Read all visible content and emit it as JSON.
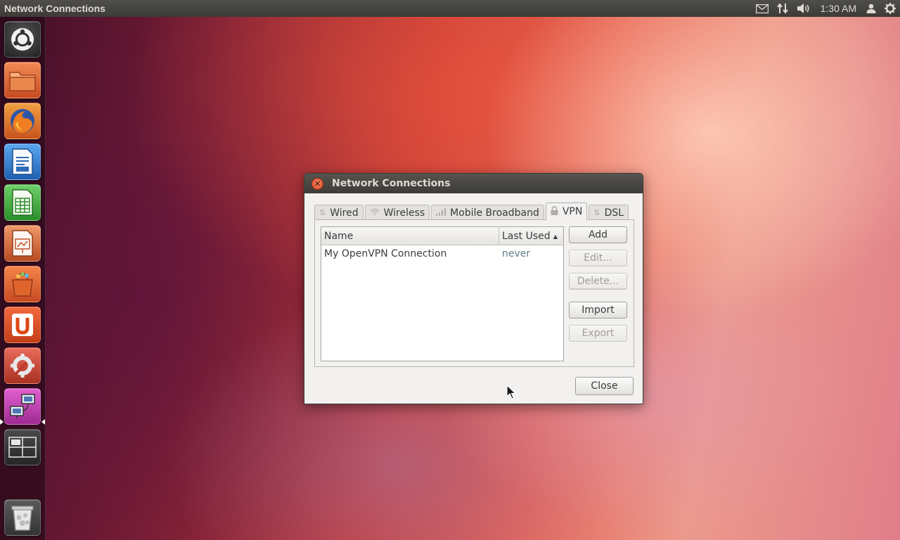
{
  "panel": {
    "title": "Network Connections",
    "clock": "1:30 AM",
    "indicators": [
      "mail-icon",
      "network-transfer-icon",
      "volume-icon",
      "user-icon",
      "power-gear-icon"
    ]
  },
  "launcher": {
    "items": [
      {
        "name": "dash-home-icon",
        "color": "#2c2c2c"
      },
      {
        "name": "files-folder-icon",
        "color": "#d9582f"
      },
      {
        "name": "firefox-icon",
        "color": "#e66d1f"
      },
      {
        "name": "writer-icon",
        "color": "#2f7fd6"
      },
      {
        "name": "calc-icon",
        "color": "#3fae3a"
      },
      {
        "name": "impress-icon",
        "color": "#c9542d"
      },
      {
        "name": "software-center-icon",
        "color": "#e2632f"
      },
      {
        "name": "ubuntu-one-icon",
        "color": "#e2522a"
      },
      {
        "name": "system-settings-icon",
        "color": "#d54a3a"
      },
      {
        "name": "network-connections-icon",
        "color": "#c93fb4"
      },
      {
        "name": "workspace-switcher-icon",
        "color": "#3a3a3a"
      },
      {
        "name": "trash-icon",
        "color": "#4a4a4a"
      }
    ]
  },
  "dialog": {
    "title": "Network Connections",
    "tabs": [
      "Wired",
      "Wireless",
      "Mobile Broadband",
      "VPN",
      "DSL"
    ],
    "active_tab": "VPN",
    "columns": {
      "name": "Name",
      "last_used": "Last Used"
    },
    "connections": [
      {
        "name": "My OpenVPN Connection",
        "last_used": "never"
      }
    ],
    "buttons": {
      "add": "Add",
      "edit": "Edit...",
      "delete": "Delete...",
      "import": "Import",
      "export": "Export",
      "close": "Close"
    }
  },
  "colors": {
    "panel": "#3c3b37",
    "dialog_bg": "#f2f1f0",
    "close_orange": "#df4a24",
    "last_used_text": "#5e7d8a"
  }
}
